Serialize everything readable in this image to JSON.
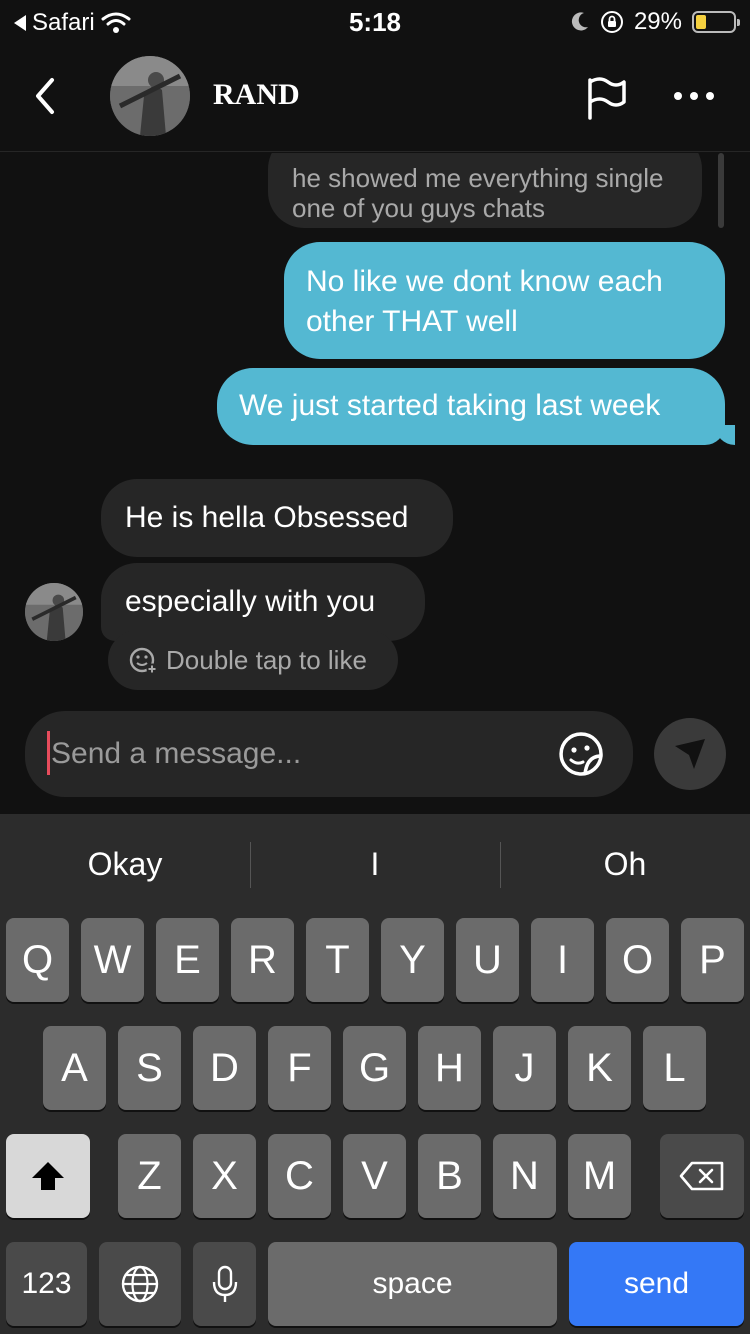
{
  "status_bar": {
    "back_app": "Safari",
    "time": "5:18",
    "battery": "29%",
    "battery_level": 0.29
  },
  "header": {
    "title": "RAND"
  },
  "messages": [
    {
      "direction": "in",
      "text_line1": "he showed me everything single",
      "text_line2": "one of you guys chats"
    },
    {
      "direction": "out",
      "text_line1": "No like we dont know each",
      "text_line2": "other THAT well"
    },
    {
      "direction": "out",
      "text": "We just started taking last week"
    },
    {
      "direction": "in",
      "text": "He is hella Obsessed"
    },
    {
      "direction": "in",
      "text": "especially with you"
    }
  ],
  "like_hint": "Double tap to like",
  "composer": {
    "placeholder": "Send a message..."
  },
  "keyboard": {
    "suggestions": [
      "Okay",
      "I",
      "Oh"
    ],
    "row1": [
      "Q",
      "W",
      "E",
      "R",
      "T",
      "Y",
      "U",
      "I",
      "O",
      "P"
    ],
    "row2": [
      "A",
      "S",
      "D",
      "F",
      "G",
      "H",
      "J",
      "K",
      "L"
    ],
    "row3": [
      "Z",
      "X",
      "C",
      "V",
      "B",
      "N",
      "M"
    ],
    "numbers_label": "123",
    "space_label": "space",
    "send_label": "send"
  },
  "colors": {
    "outgoing_bubble": "#54b8d2",
    "incoming_bubble": "#262626",
    "send_key": "#3478f6",
    "caret": "#e74c5c"
  }
}
